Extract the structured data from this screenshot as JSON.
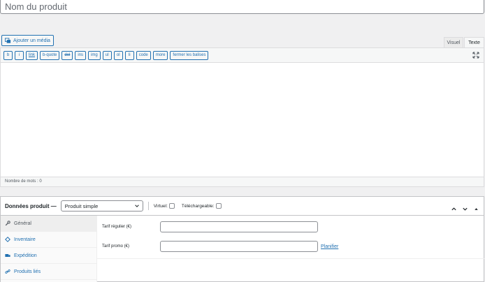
{
  "title": {
    "placeholder": "Nom du produit",
    "value": ""
  },
  "media": {
    "add_label": "Ajouter un média"
  },
  "editor": {
    "tabs": [
      {
        "label": "Visuel"
      },
      {
        "label": "Texte"
      }
    ],
    "quicktags": [
      "b",
      "i",
      "link",
      "b-quote",
      "del",
      "ins",
      "img",
      "ul",
      "ol",
      "li",
      "code",
      "more",
      "fermer les balises"
    ],
    "word_count": "Nombre de mots : 0"
  },
  "product_data": {
    "title": "Données produit —",
    "product_type": "Produit simple",
    "virtual_label": "Virtuel:",
    "downloadable_label": "Téléchargeable:",
    "tabs": [
      {
        "label": "Général",
        "icon": "wrench-icon"
      },
      {
        "label": "Inventaire",
        "icon": "tag-icon"
      },
      {
        "label": "Expédition",
        "icon": "truck-icon"
      },
      {
        "label": "Produits liés",
        "icon": "link-icon"
      }
    ],
    "fields": {
      "regular_price_label": "Tarif régulier (€)",
      "sale_price_label": "Tarif promo (€)",
      "schedule_link": "Planifier"
    }
  },
  "colors": {
    "accent": "#2271b1",
    "border": "#c3c4c7",
    "background": "#f0f0f1"
  }
}
